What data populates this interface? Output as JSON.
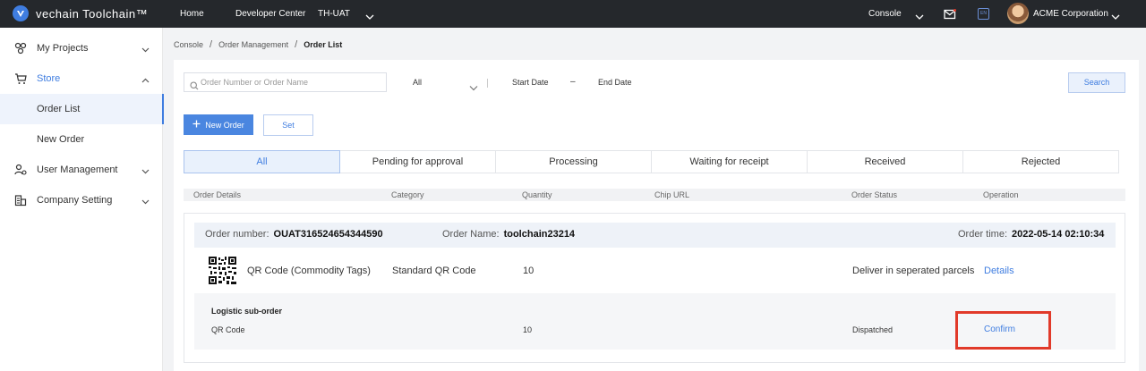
{
  "topbar": {
    "brand": "vechain Toolchain™",
    "nav": [
      "Home",
      "Developer Center",
      "TH-UAT"
    ],
    "console": "Console",
    "lang": "EN",
    "company": "ACME Corporation"
  },
  "sidebar": {
    "items": [
      {
        "label": "My Projects",
        "icon": "projects-icon"
      },
      {
        "label": "Store",
        "icon": "store-cart-icon"
      },
      {
        "label": "Order List"
      },
      {
        "label": "New Order"
      },
      {
        "label": "User Management",
        "icon": "user-management-icon"
      },
      {
        "label": "Company Setting",
        "icon": "company-building-icon"
      }
    ]
  },
  "breadcrumb": [
    "Console",
    "Order Management",
    "Order List"
  ],
  "filters": {
    "search_placeholder": "Order Number or Order Name",
    "status_value": "All",
    "start_date": "Start Date",
    "dash": "–",
    "end_date": "End Date",
    "search_button": "Search"
  },
  "actions": {
    "new_order": "New Order",
    "set": "Set"
  },
  "tabs": [
    "All",
    "Pending for approval",
    "Processing",
    "Waiting for receipt",
    "Received",
    "Rejected"
  ],
  "columns": [
    "Order Details",
    "Category",
    "Quantity",
    "Chip URL",
    "Order Status",
    "Operation"
  ],
  "order": {
    "number_label": "Order number:",
    "number": "OUAT316524654344590",
    "name_label": "Order Name:",
    "name": "toolchain23214",
    "time_label": "Order time:",
    "time": "2022-05-14 02:10:34",
    "item": {
      "title": "QR Code (Commodity Tags)",
      "category": "Standard QR Code",
      "quantity": "10",
      "status": "Deliver in seperated parcels",
      "operation": "Details"
    },
    "sub_order": {
      "title": "Logistic sub-order",
      "name": "QR Code",
      "quantity": "10",
      "status": "Dispatched",
      "operation": "Confirm"
    }
  },
  "colors": {
    "accent": "#3f7de0",
    "topbar": "#25282c",
    "highlight": "#e13a2a"
  }
}
